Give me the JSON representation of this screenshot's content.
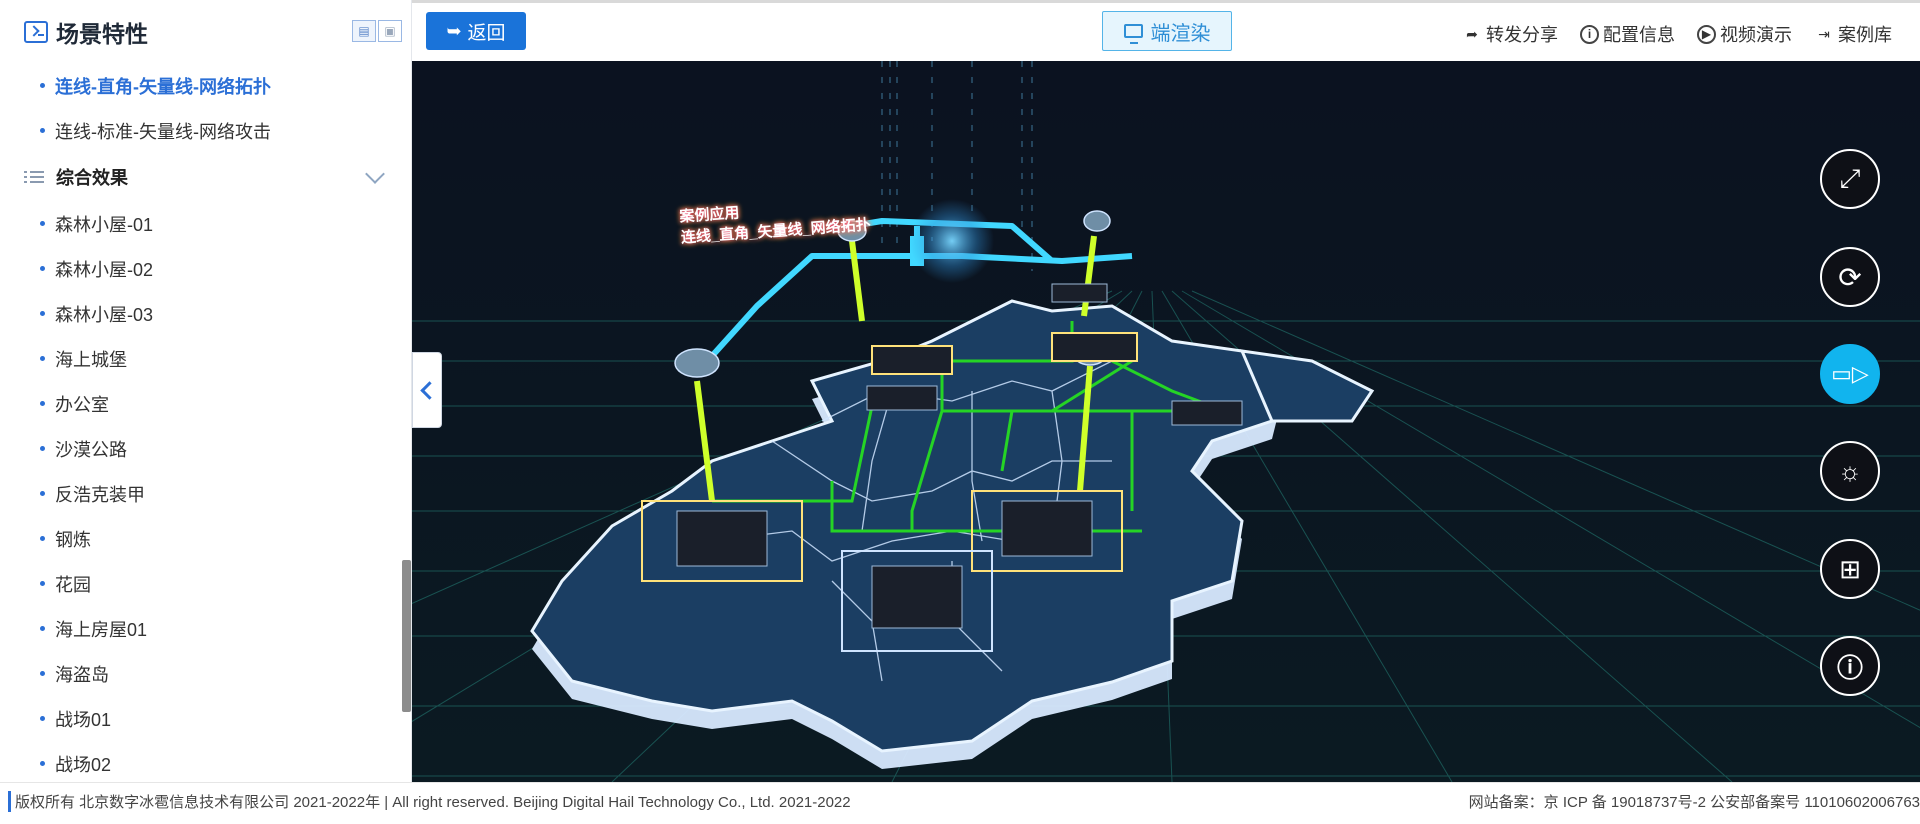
{
  "sidebar": {
    "title": "场景特性",
    "items_before": [
      {
        "label": "连线-直角-矢量线-网络拓扑",
        "active": true
      },
      {
        "label": "连线-标准-矢量线-网络攻击",
        "active": false
      }
    ],
    "group": {
      "label": "综合效果"
    },
    "items_after": [
      "森林小屋-01",
      "森林小屋-02",
      "森林小屋-03",
      "海上城堡",
      "办公室",
      "沙漠公路",
      "反浩克装甲",
      "钢炼",
      "花园",
      "海上房屋01",
      "海盗岛",
      "战场01",
      "战场02"
    ]
  },
  "topbar": {
    "back_label": "返回",
    "render_label": "端渲染",
    "links": [
      "转发分享",
      "配置信息",
      "视频演示",
      "案例库"
    ]
  },
  "scene": {
    "caption_line1": "案例应用",
    "caption_line2": "连线_直角_矢量线_网络拓扑",
    "colors": {
      "route": "#41d8ff",
      "link": "#cfff2a",
      "grid": "#1f6b66",
      "region": "#1b3e63",
      "edge": "#e8f4ff"
    }
  },
  "tools": [
    "fullscreen-icon",
    "rotate-icon",
    "camera-icon",
    "weather-icon",
    "grid-icon",
    "info-icon"
  ],
  "footer": {
    "copyright": "版权所有 北京数字冰雹信息技术有限公司 2021-2022年 | All right reserved. Beijing Digital Hail Technology Co., Ltd. 2021-2022",
    "icp": "网站备案：京 ICP 备 19018737号-2 公安部备案号 11010602006763"
  }
}
